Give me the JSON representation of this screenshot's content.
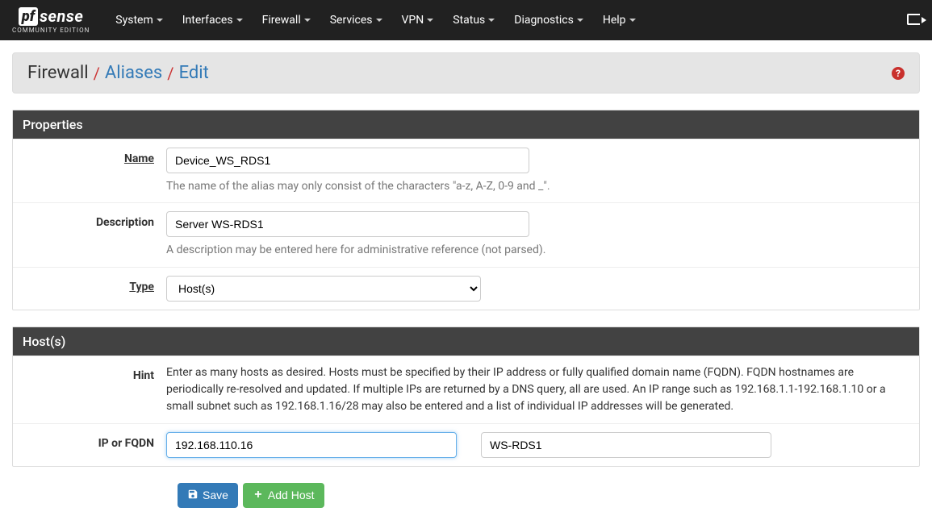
{
  "logo": {
    "left": "pf",
    "right": "sense",
    "sub": "COMMUNITY EDITION"
  },
  "nav": {
    "items": [
      "System",
      "Interfaces",
      "Firewall",
      "Services",
      "VPN",
      "Status",
      "Diagnostics",
      "Help"
    ]
  },
  "breadcrumb": {
    "p1": "Firewall",
    "p2": "Aliases",
    "p3": "Edit"
  },
  "panels": {
    "properties": {
      "title": "Properties",
      "name": {
        "label": "Name",
        "value": "Device_WS_RDS1",
        "help": "The name of the alias may only consist of the characters \"a-z, A-Z, 0-9 and _\"."
      },
      "description": {
        "label": "Description",
        "value": "Server WS-RDS1",
        "help": "A description may be entered here for administrative reference (not parsed)."
      },
      "type": {
        "label": "Type",
        "value": "Host(s)"
      }
    },
    "hosts": {
      "title": "Host(s)",
      "hint_label": "Hint",
      "hint": "Enter as many hosts as desired. Hosts must be specified by their IP address or fully qualified domain name (FQDN). FQDN hostnames are periodically re-resolved and updated. If multiple IPs are returned by a DNS query, all are used. An IP range such as 192.168.1.1-192.168.1.10 or a small subnet such as 192.168.1.16/28 may also be entered and a list of individual IP addresses will be generated.",
      "row_label": "IP or FQDN",
      "entries": [
        {
          "addr": "192.168.110.16",
          "desc": "WS-RDS1"
        }
      ]
    }
  },
  "buttons": {
    "save": "Save",
    "add_host": "Add Host"
  }
}
